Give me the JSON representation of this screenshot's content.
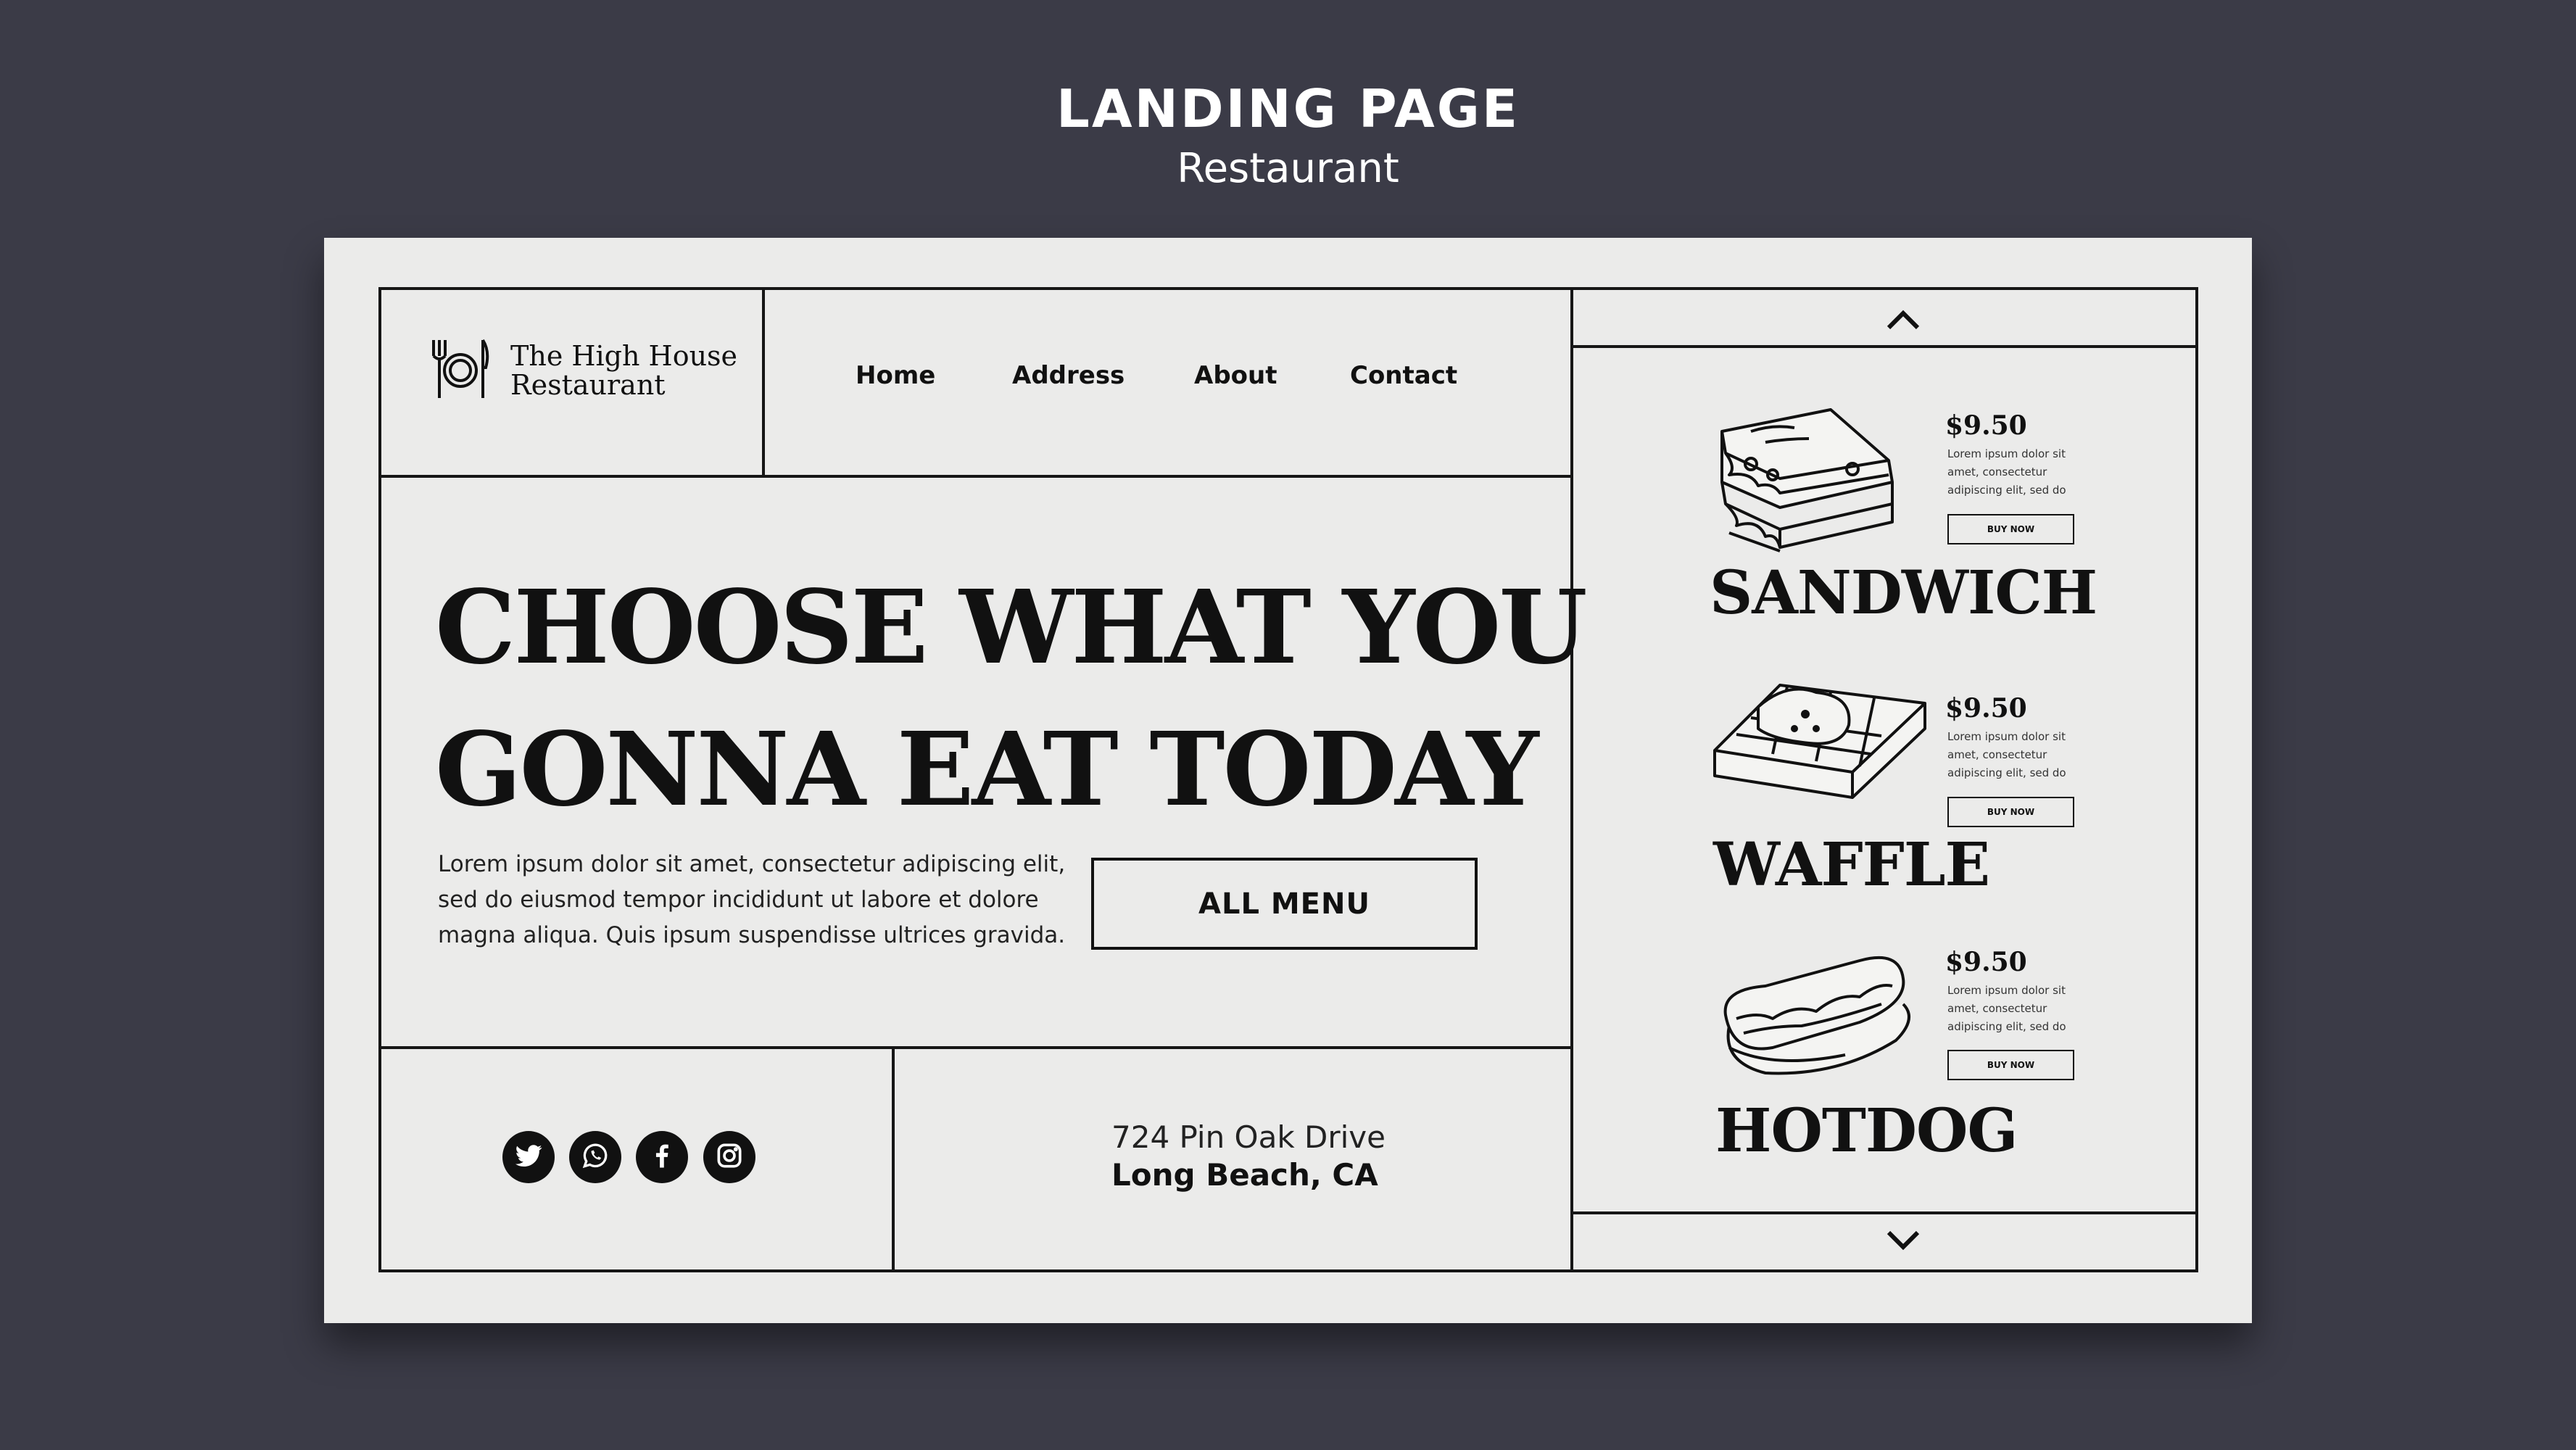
{
  "presentation": {
    "title": "LANDING PAGE",
    "subtitle": "Restaurant"
  },
  "logo": {
    "line1": "The High House",
    "line2": "Restaurant",
    "icon": "fork-plate-knife-icon"
  },
  "nav": {
    "items": [
      {
        "label": "Home"
      },
      {
        "label": "Address"
      },
      {
        "label": "About"
      },
      {
        "label": "Contact"
      }
    ]
  },
  "hero": {
    "title_line1": "CHOOSE WHAT YOU",
    "title_line2": "GONNA EAT TODAY",
    "body": "Lorem ipsum dolor sit amet, consectetur adipiscing elit, sed do eiusmod tempor incididunt ut labore et dolore magna aliqua. Quis ipsum suspendisse ultrices gravida.",
    "cta": "ALL MENU"
  },
  "social": [
    {
      "icon": "twitter-icon"
    },
    {
      "icon": "whatsapp-icon"
    },
    {
      "icon": "facebook-icon"
    },
    {
      "icon": "instagram-icon"
    }
  ],
  "address": {
    "line1": "724 Pin Oak Drive",
    "line2": "Long Beach, CA"
  },
  "menu": {
    "up_icon": "chevron-up-icon",
    "down_icon": "chevron-down-icon",
    "items": [
      {
        "name": "SANDWICH",
        "price": "$9.50",
        "desc": "Lorem ipsum dolor sit amet, consectetur adipiscing elit, sed do",
        "button": "BUY NOW",
        "icon": "sandwich-icon"
      },
      {
        "name": "WAFFLE",
        "price": "$9.50",
        "desc": "Lorem ipsum dolor sit amet, consectetur adipiscing elit, sed do",
        "button": "BUY NOW",
        "icon": "waffle-icon"
      },
      {
        "name": "HOTDOG",
        "price": "$9.50",
        "desc": "Lorem ipsum dolor sit amet, consectetur adipiscing elit, sed do",
        "button": "BUY NOW",
        "icon": "hotdog-icon"
      }
    ]
  },
  "colors": {
    "background": "#3b3b47",
    "card": "#ebebea",
    "ink": "#111111"
  }
}
